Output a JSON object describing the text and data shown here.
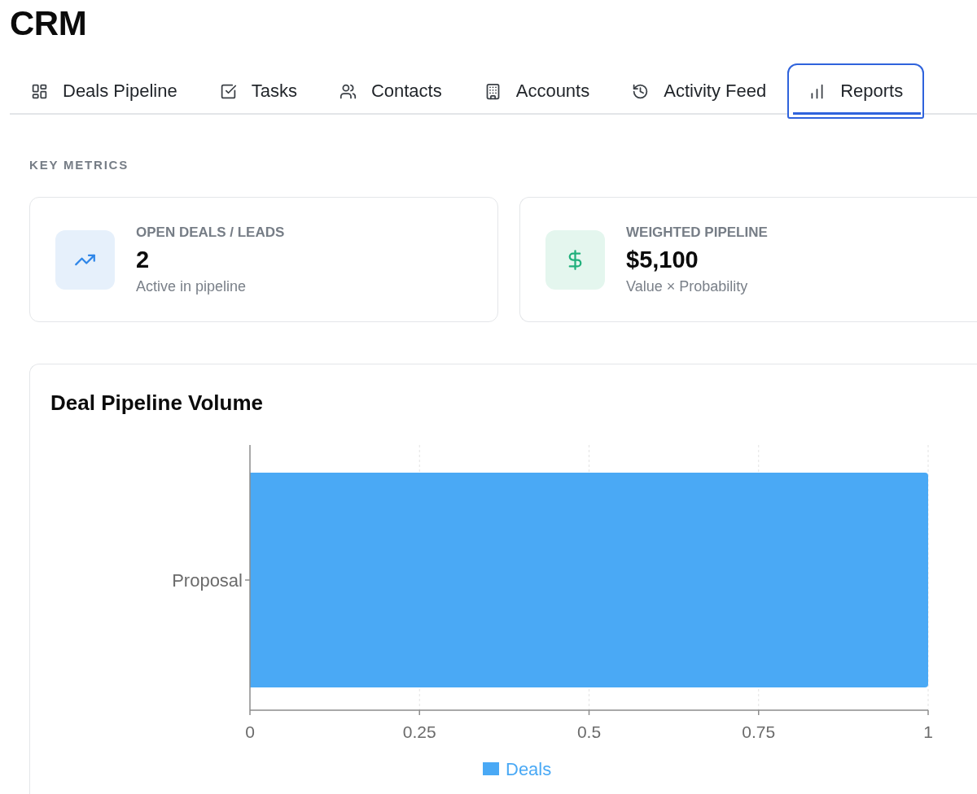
{
  "app": {
    "title": "CRM"
  },
  "tabs": [
    {
      "label": "Deals Pipeline",
      "kind": "pipeline",
      "selected": false
    },
    {
      "label": "Tasks",
      "kind": "tasks",
      "selected": false
    },
    {
      "label": "Contacts",
      "kind": "contacts",
      "selected": false
    },
    {
      "label": "Accounts",
      "kind": "accounts",
      "selected": false
    },
    {
      "label": "Activity Feed",
      "kind": "activity",
      "selected": false
    },
    {
      "label": "Reports",
      "kind": "reports",
      "selected": true
    }
  ],
  "key_metrics": {
    "heading": "KEY METRICS",
    "cards": [
      {
        "kind": "trend",
        "label": "OPEN DEALS / LEADS",
        "value": "2",
        "caption": "Active in pipeline"
      },
      {
        "kind": "dollar",
        "label": "WEIGHTED PIPELINE",
        "value": "$5,100",
        "caption": "Value × Probability"
      }
    ]
  },
  "pipeline_chart": {
    "chart_data": {
      "type": "bar",
      "orientation": "horizontal",
      "title": "Deal Pipeline Volume",
      "categories": [
        "Proposal"
      ],
      "series": [
        {
          "name": "Deals",
          "color": "#4aa9f5",
          "values": [
            1
          ]
        }
      ],
      "xlim": [
        0,
        1
      ],
      "xticks": [
        0,
        0.25,
        0.5,
        0.75,
        1
      ],
      "grid": true
    }
  }
}
